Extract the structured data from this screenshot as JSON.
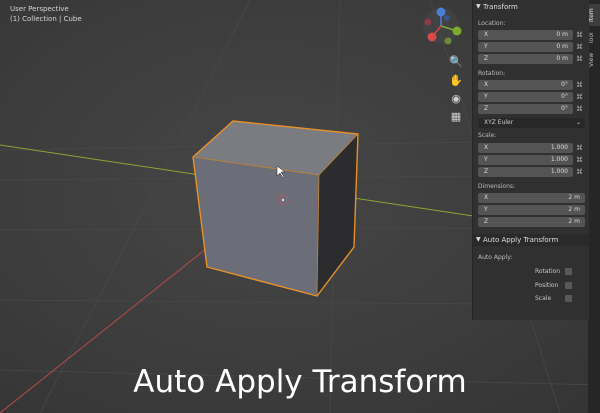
{
  "viewport": {
    "title": "User Perspective",
    "subtitle": "(1) Collection | Cube",
    "nav_icons": [
      "zoom-icon",
      "hand-pan-icon",
      "camera-icon",
      "grid-icon"
    ]
  },
  "tabs": [
    "Item",
    "Tool",
    "View"
  ],
  "transform_panel": {
    "title": "Transform",
    "location_label": "Location:",
    "location": [
      {
        "axis": "X",
        "value": "0 m"
      },
      {
        "axis": "Y",
        "value": "0 m"
      },
      {
        "axis": "Z",
        "value": "0 m"
      }
    ],
    "rotation_label": "Rotation:",
    "rotation": [
      {
        "axis": "X",
        "value": "0°"
      },
      {
        "axis": "Y",
        "value": "0°"
      },
      {
        "axis": "Z",
        "value": "0°"
      }
    ],
    "rotation_mode": "XYZ Euler",
    "scale_label": "Scale:",
    "scale": [
      {
        "axis": "X",
        "value": "1.000"
      },
      {
        "axis": "Y",
        "value": "1.000"
      },
      {
        "axis": "Z",
        "value": "1.000"
      }
    ],
    "dimensions_label": "Dimensions:",
    "dimensions": [
      {
        "axis": "X",
        "value": "2 m"
      },
      {
        "axis": "Y",
        "value": "2 m"
      },
      {
        "axis": "Z",
        "value": "2 m"
      }
    ]
  },
  "auto_apply_panel": {
    "title": "Auto Apply Transform",
    "label": "Auto Apply:",
    "options": [
      {
        "label": "Rotation",
        "checked": false
      },
      {
        "label": "Position",
        "checked": false
      },
      {
        "label": "Scale",
        "checked": false
      }
    ]
  },
  "caption": "Auto Apply Transform",
  "colors": {
    "selection_outline": "#e8902a",
    "x_axis": "#b94a48",
    "y_axis": "#8aa632"
  }
}
